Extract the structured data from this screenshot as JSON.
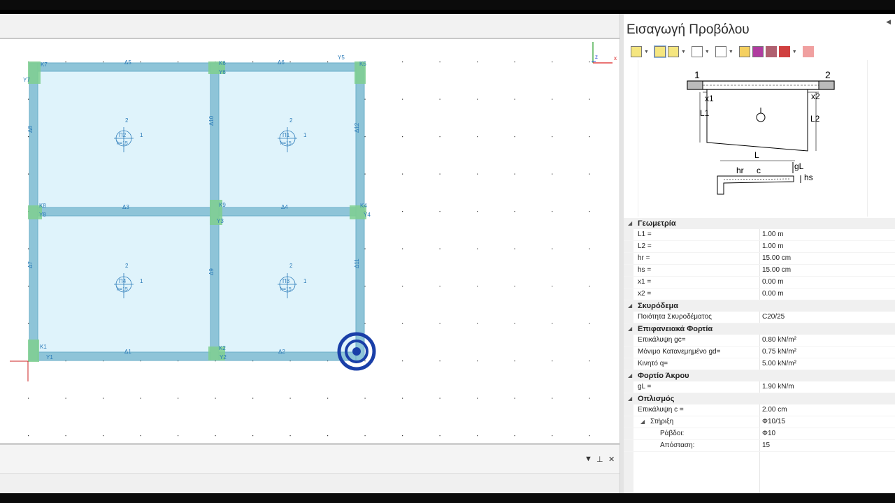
{
  "panel": {
    "title": "Εισαγωγή Προβόλου"
  },
  "diagram": {
    "label_1": "1",
    "label_2": "2",
    "x1": "x1",
    "x2": "x2",
    "L1": "L1",
    "L2": "L2",
    "L": "L",
    "hr": "hr",
    "c": "c",
    "gL": "gL",
    "hs": "hs"
  },
  "properties": {
    "cat_geometry": "Γεωμετρία",
    "geometry": [
      {
        "k": "L1 =",
        "v": "1.00 m"
      },
      {
        "k": "L2 =",
        "v": "1.00 m"
      },
      {
        "k": "hr =",
        "v": "15.00 cm"
      },
      {
        "k": "hs =",
        "v": "15.00 cm"
      },
      {
        "k": "x1 =",
        "v": "0.00 m"
      },
      {
        "k": "x2 =",
        "v": "0.00 m"
      }
    ],
    "cat_concrete": "Σκυρόδεμα",
    "concrete": [
      {
        "k": "Ποιότητα Σκυροδέματος",
        "v": "C20/25"
      }
    ],
    "cat_surface": "Επιφανειακά Φορτία",
    "surface": [
      {
        "k": "Επικάλυψη gc=",
        "v": "0.80 kN/m²"
      },
      {
        "k": "Μόνιμο Κατανεμημένο gd=",
        "v": "0.75 kN/m²"
      },
      {
        "k": "Κινητό q=",
        "v": "5.00 kN/m²"
      }
    ],
    "cat_tip": "Φορτίο Άκρου",
    "tip": [
      {
        "k": "gL =",
        "v": "1.90 kN/m"
      }
    ],
    "cat_rebar": "Οπλισμός",
    "rebar_cover": {
      "k": "Επικάλυψη c =",
      "v": "2.00 cm"
    },
    "support": {
      "k": "Στήριξη",
      "v": "Φ10/15"
    },
    "bars": {
      "k": "Ράβδοι:",
      "v": "Φ10"
    },
    "spacing": {
      "k": "Απόσταση:",
      "v": "15"
    }
  },
  "plan": {
    "columns": [
      "K7",
      "K6",
      "K5",
      "K8",
      "K9",
      "K4",
      "K1",
      "K2"
    ],
    "beams": [
      "Δ5",
      "Δ6",
      "Δ3",
      "Δ4",
      "Δ1",
      "Δ2",
      "Δ8",
      "Δ10",
      "Δ12",
      "Δ7",
      "Δ9",
      "Δ11"
    ],
    "slabs": [
      {
        "name": "Π2",
        "h": "h=15"
      },
      {
        "name": "Π1",
        "h": "h=15"
      },
      {
        "name": "Π4",
        "h": "h=15"
      },
      {
        "name": "Π3",
        "h": "h=15"
      }
    ],
    "col_marks": [
      "Y5",
      "Y7",
      "Y6",
      "Y8",
      "Y3",
      "Y4",
      "Y1",
      "Y2"
    ],
    "slab_dir_1": "1",
    "slab_dir_2": "2",
    "axis_z": "z",
    "axis_x": "x"
  },
  "colors": {
    "slab_fill": "#dff3fb",
    "beam": "#8ec4d8",
    "column": "#7fcf8f",
    "text_blue": "#2a7ab8",
    "target": "#1a3fa8"
  }
}
